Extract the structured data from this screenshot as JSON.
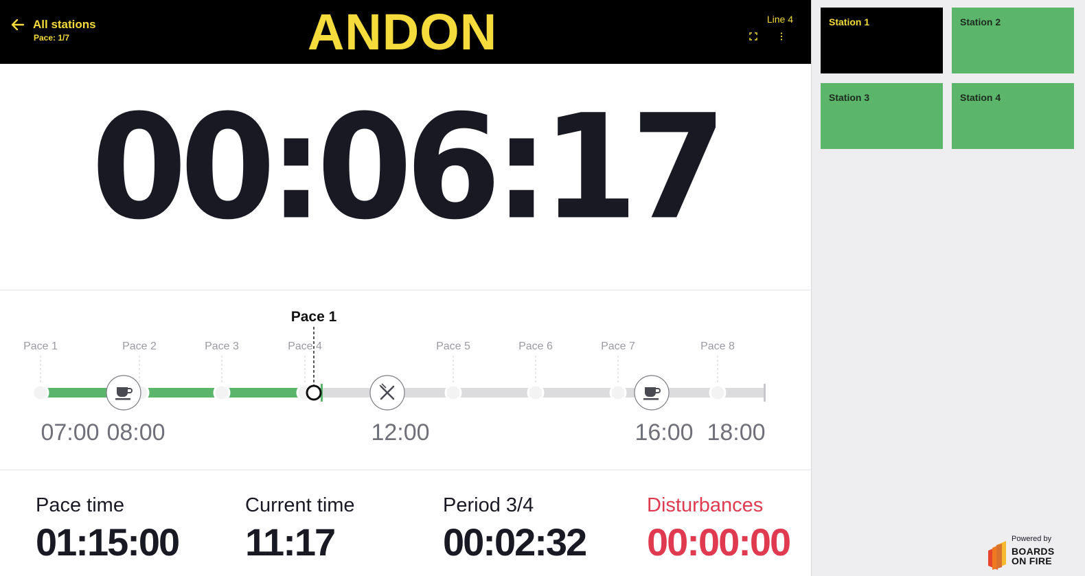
{
  "header": {
    "back_label": "All stations",
    "pace_status": "Pace: 1/7",
    "brand": "ANDON",
    "line": "Line 4",
    "icons": [
      "arrow-left-icon",
      "fullscreen-icon",
      "more-vert-icon"
    ]
  },
  "timer": {
    "value": "00:06:17"
  },
  "timeline": {
    "current_marker_label": "Pace 1",
    "current_fraction": 0.37,
    "pace_labels": [
      "Pace 1",
      "Pace 2",
      "Pace 3",
      "Pace 4",
      "Pace 5",
      "Pace 6",
      "Pace 7",
      "Pace 8"
    ],
    "time_labels": [
      "07:00",
      "08:00",
      "12:00",
      "16:00",
      "18:00"
    ],
    "break_icons": [
      "coffee-icon",
      "utensils-icon",
      "coffee-icon"
    ]
  },
  "stats": {
    "pace_time": {
      "label": "Pace time",
      "value": "01:15:00"
    },
    "current_time": {
      "label": "Current time",
      "value": "11:17"
    },
    "period": {
      "label": "Period 3/4",
      "value": "00:02:32"
    },
    "disturbances": {
      "label": "Disturbances",
      "value": "00:00:00"
    }
  },
  "stations": [
    {
      "label": "Station 1",
      "status": "active"
    },
    {
      "label": "Station 2",
      "status": "ok"
    },
    {
      "label": "Station 3",
      "status": "ok"
    },
    {
      "label": "Station 4",
      "status": "ok"
    }
  ],
  "footer": {
    "powered_by": "Powered by",
    "brand_line1": "BOARDS",
    "brand_line2": "ON FIRE"
  },
  "colors": {
    "accent_yellow": "#f5dc3c",
    "header_bg": "#000000",
    "progress_green": "#5bb56b",
    "track_grey": "#dcdcde",
    "alert_red": "#df3a50",
    "text_dark": "#181923"
  }
}
